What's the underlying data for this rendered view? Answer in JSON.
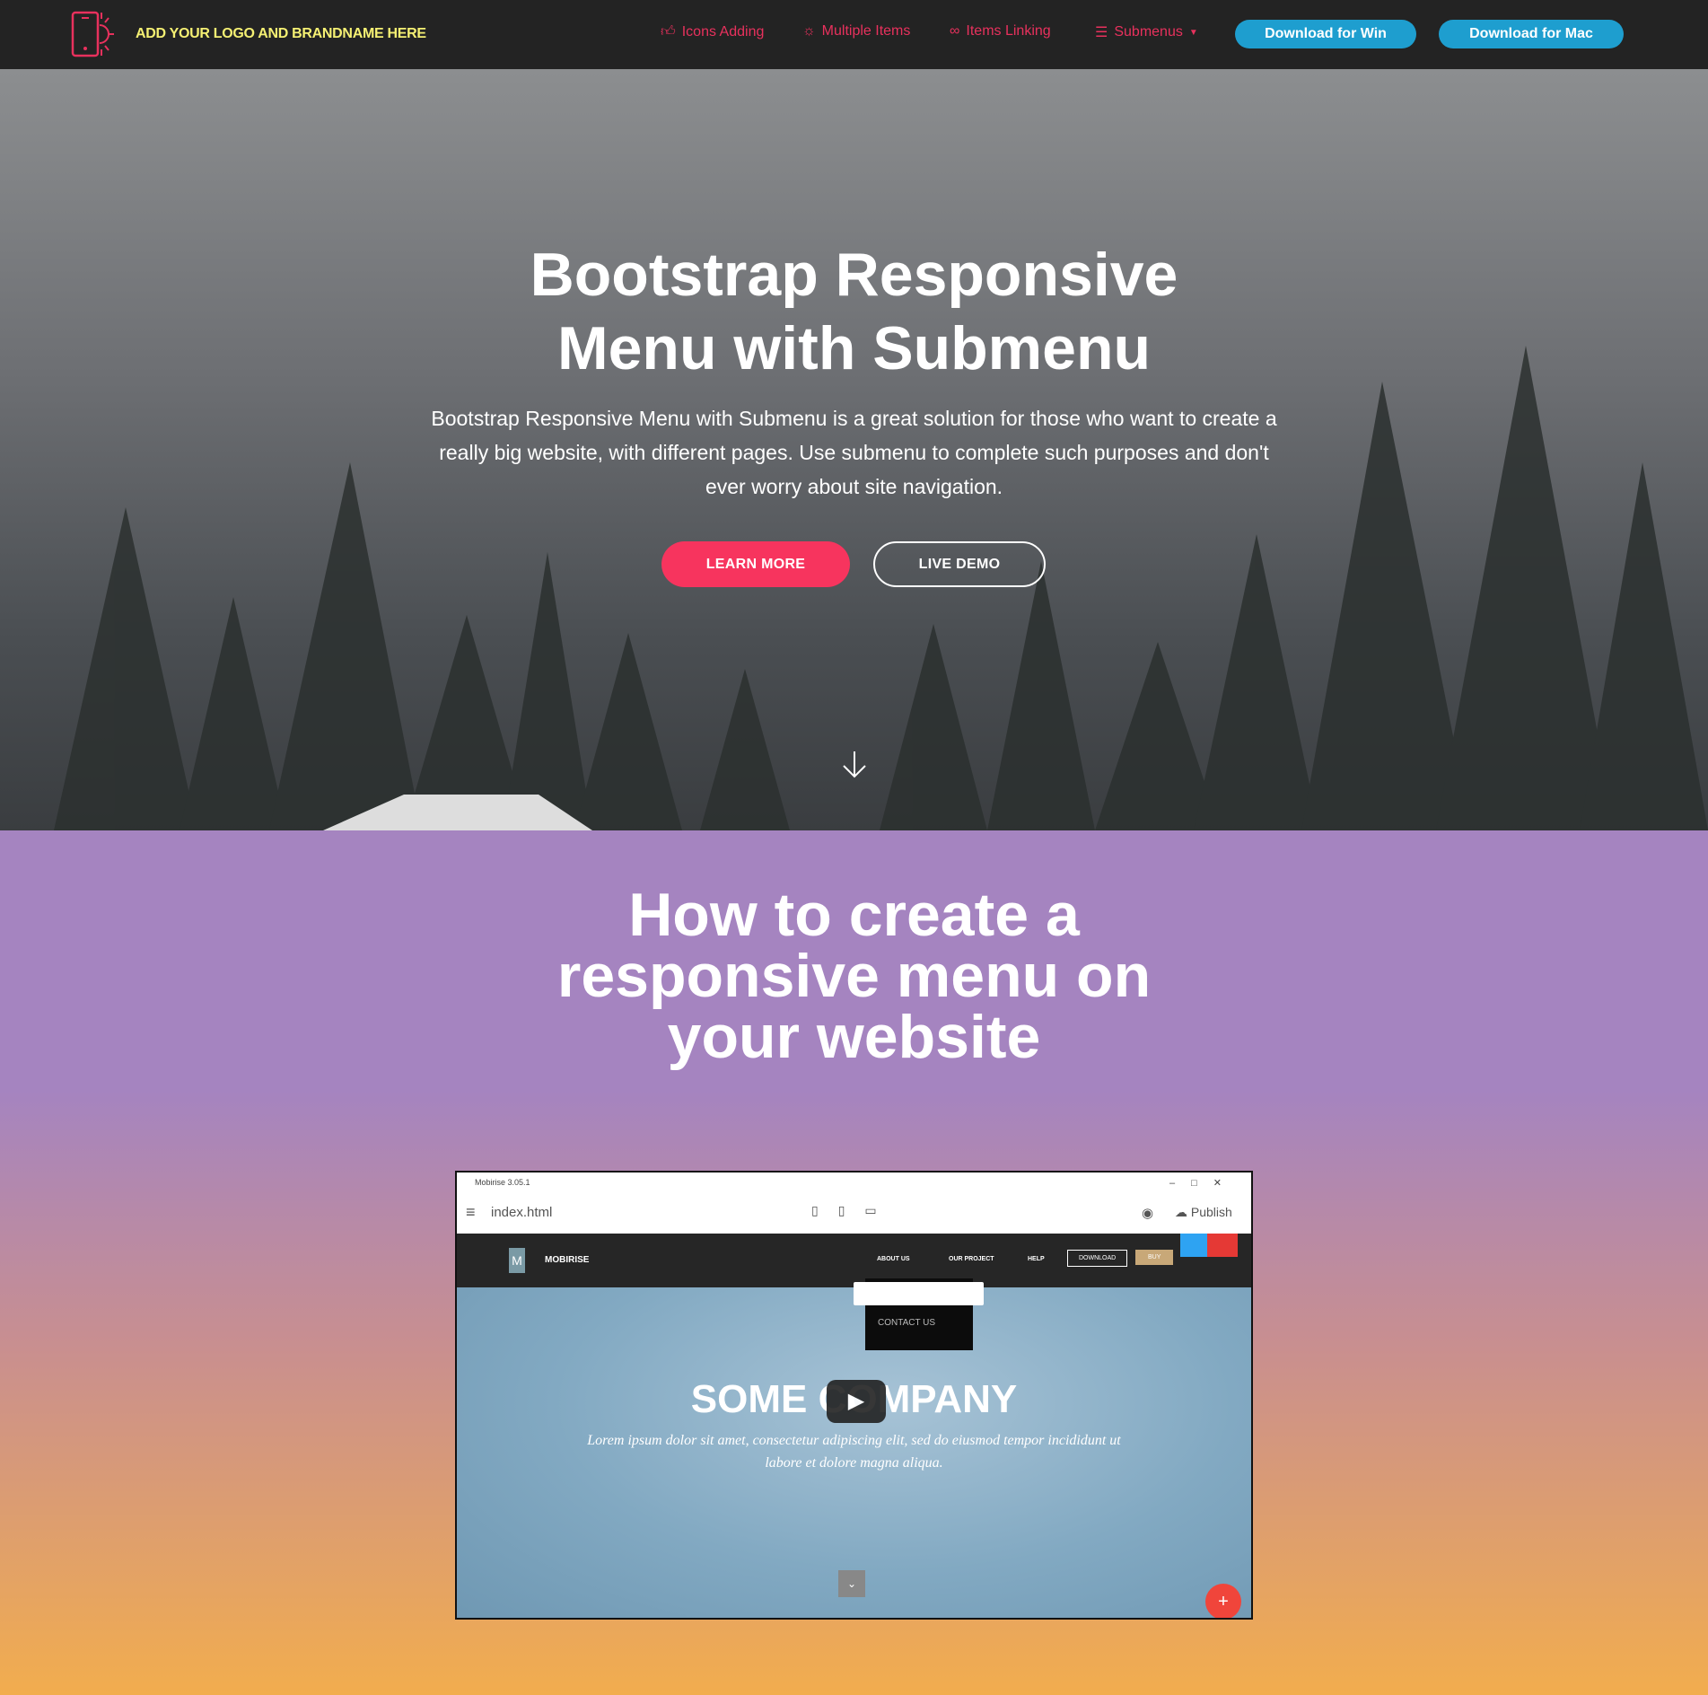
{
  "navbar": {
    "brand": "ADD YOUR LOGO AND BRANDNAME HERE",
    "items": [
      {
        "label": "Icons Adding",
        "icon": "thumbs-up-icon"
      },
      {
        "label": "Multiple Items",
        "icon": "lightbulb-icon"
      },
      {
        "label": "Items Linking",
        "icon": "link-icon"
      },
      {
        "label": "Submenus",
        "icon": "list-icon"
      }
    ],
    "download_win": "Download for Win",
    "download_mac": "Download for Mac",
    "colors": {
      "link": "#e8315d",
      "brand": "#f5f073",
      "button": "#1e9ecf"
    }
  },
  "hero": {
    "title_line1": "Bootstrap Responsive",
    "title_line2": "Menu with Submenu",
    "text": "Bootstrap Responsive Menu with Submenu is a great solution for those who want to create a really big website, with different pages. Use submenu to complete such purposes and don't ever worry about site navigation.",
    "learn_more": "LEARN MORE",
    "live_demo": "LIVE DEMO"
  },
  "section2": {
    "title_line1": "How to create a",
    "title_line2": "responsive menu on",
    "title_line3": "your website"
  },
  "video": {
    "window_title": "Mobirise 3.05.1",
    "file": "index.html",
    "publish": "Publish",
    "site_brand": "MOBIRISE",
    "site_nav": [
      "ABOUT US",
      "OUR PROJECT",
      "HELP"
    ],
    "site_download": "DOWNLOAD",
    "site_buy": "BUY",
    "dropdown_item": "CONTACT US",
    "heading": "SOME COMPANY",
    "lorem": "Lorem ipsum dolor sit amet, consectetur adipiscing elit, sed do eiusmod tempor incididunt ut labore et dolore magna aliqua."
  }
}
